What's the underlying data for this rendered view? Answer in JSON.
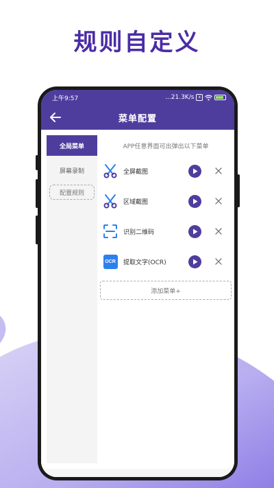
{
  "hero": {
    "title": "规则自定义"
  },
  "status_bar": {
    "time": "上午9:57",
    "network": "...21.3K/s",
    "sim_badge": "x"
  },
  "app_bar": {
    "title": "菜单配置",
    "back_icon": "arrow-left-icon"
  },
  "sidebar": {
    "items": [
      {
        "label": "全局菜单",
        "active": true
      },
      {
        "label": "屏幕录制",
        "active": false
      }
    ],
    "config_label": "配置规则"
  },
  "content": {
    "hint": "APP任意界面可出弹出以下菜单",
    "menu": [
      {
        "label": "全屏截图",
        "icon": "scissors-icon"
      },
      {
        "label": "区域截图",
        "icon": "scissors-icon"
      },
      {
        "label": "识别二维码",
        "icon": "scan-frame-icon"
      },
      {
        "label": "提取文字(OCR)",
        "icon": "ocr-icon",
        "badge": "OCR"
      }
    ],
    "add_label": "添加菜单+"
  },
  "colors": {
    "accent": "#4f3d9e",
    "hero_text": "#4b2ca6",
    "icon_blue": "#2d7ff0"
  }
}
